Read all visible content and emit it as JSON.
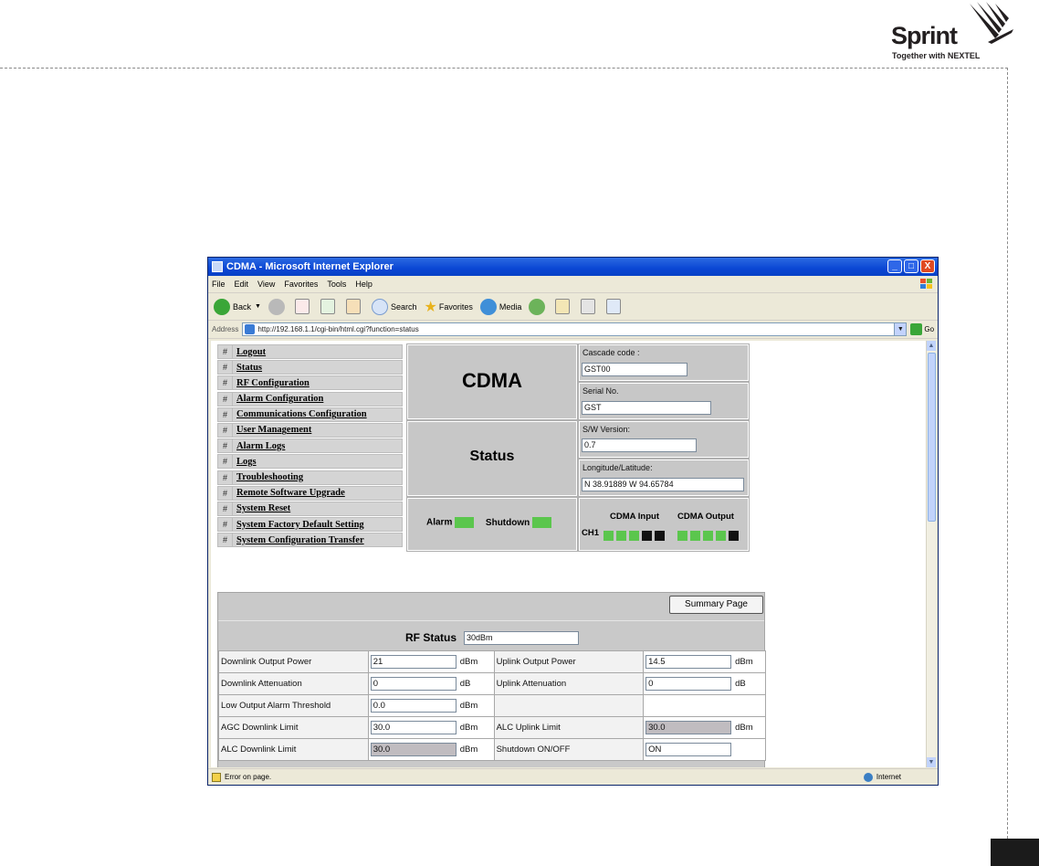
{
  "brand": {
    "name": "Sprint",
    "tagline": "Together with NEXTEL"
  },
  "window": {
    "title": "CDMA - Microsoft Internet Explorer",
    "minimize": "_",
    "maximize": "□",
    "close": "X"
  },
  "menu": [
    "File",
    "Edit",
    "View",
    "Favorites",
    "Tools",
    "Help"
  ],
  "toolbar": {
    "back": "Back",
    "search": "Search",
    "favorites": "Favorites",
    "media": "Media"
  },
  "address": {
    "label": "Address",
    "url": "http://192.168.1.1/cgi-bin/html.cgi?function=status",
    "go": "Go"
  },
  "nav": {
    "bullet": "#",
    "items": [
      "Logout",
      "Status",
      "RF Configuration",
      "Alarm Configuration",
      "Communications Configuration",
      "User Management",
      "Alarm Logs",
      "Logs",
      "Troubleshooting",
      "Remote Software Upgrade",
      "System Reset",
      "System Factory Default Setting",
      "System Configuration Transfer"
    ]
  },
  "header": {
    "title": "CDMA",
    "subtitle": "Status",
    "cascade_label": "Cascade code :",
    "cascade_value": "GST00",
    "serial_label": "Serial No.",
    "serial_value": "GST",
    "sw_label": "S/W Version:",
    "sw_value": "0.7",
    "geo_label": "Longitude/Latitude:",
    "geo_value": "N 38.91889 W 94.65784"
  },
  "indicators": {
    "alarm_label": "Alarm",
    "shutdown_label": "Shutdown",
    "input_label": "CDMA Input",
    "output_label": "CDMA Output",
    "channel_label": "CH1",
    "input_leds": [
      "green",
      "green",
      "green",
      "black",
      "black"
    ],
    "output_leds": [
      "green",
      "green",
      "green",
      "green",
      "black"
    ]
  },
  "rf": {
    "summary_button": "Summary Page",
    "title": "RF Status",
    "title_value": "30dBm",
    "rows": [
      {
        "l_label": "Downlink Output Power",
        "l_value": "21",
        "l_unit": "dBm",
        "r_label": "Uplink Output Power",
        "r_value": "14.5",
        "r_unit": "dBm"
      },
      {
        "l_label": "Downlink Attenuation",
        "l_value": "0",
        "l_unit": "dB",
        "r_label": "Uplink Attenuation",
        "r_value": "0",
        "r_unit": "dB"
      },
      {
        "l_label": "Low Output Alarm Threshold",
        "l_value": "0.0",
        "l_unit": "dBm",
        "r_label": "",
        "r_value": "",
        "r_unit": ""
      },
      {
        "l_label": "AGC Downlink Limit",
        "l_value": "30.0",
        "l_unit": "dBm",
        "r_label": "ALC Uplink Limit",
        "r_value": "30.0",
        "r_unit": "dBm"
      },
      {
        "l_label": "ALC Downlink Limit",
        "l_value": "30.0",
        "l_unit": "dBm",
        "r_label": "Shutdown ON/OFF",
        "r_value": "ON",
        "r_unit": ""
      }
    ]
  },
  "status": {
    "message": "Error on page.",
    "zone": "Internet"
  },
  "colors": {
    "led_green": "#5bc64d",
    "led_off": "#111111",
    "panel_grey": "#c7c7c7",
    "titlebar_blue": "#0a46d4"
  }
}
